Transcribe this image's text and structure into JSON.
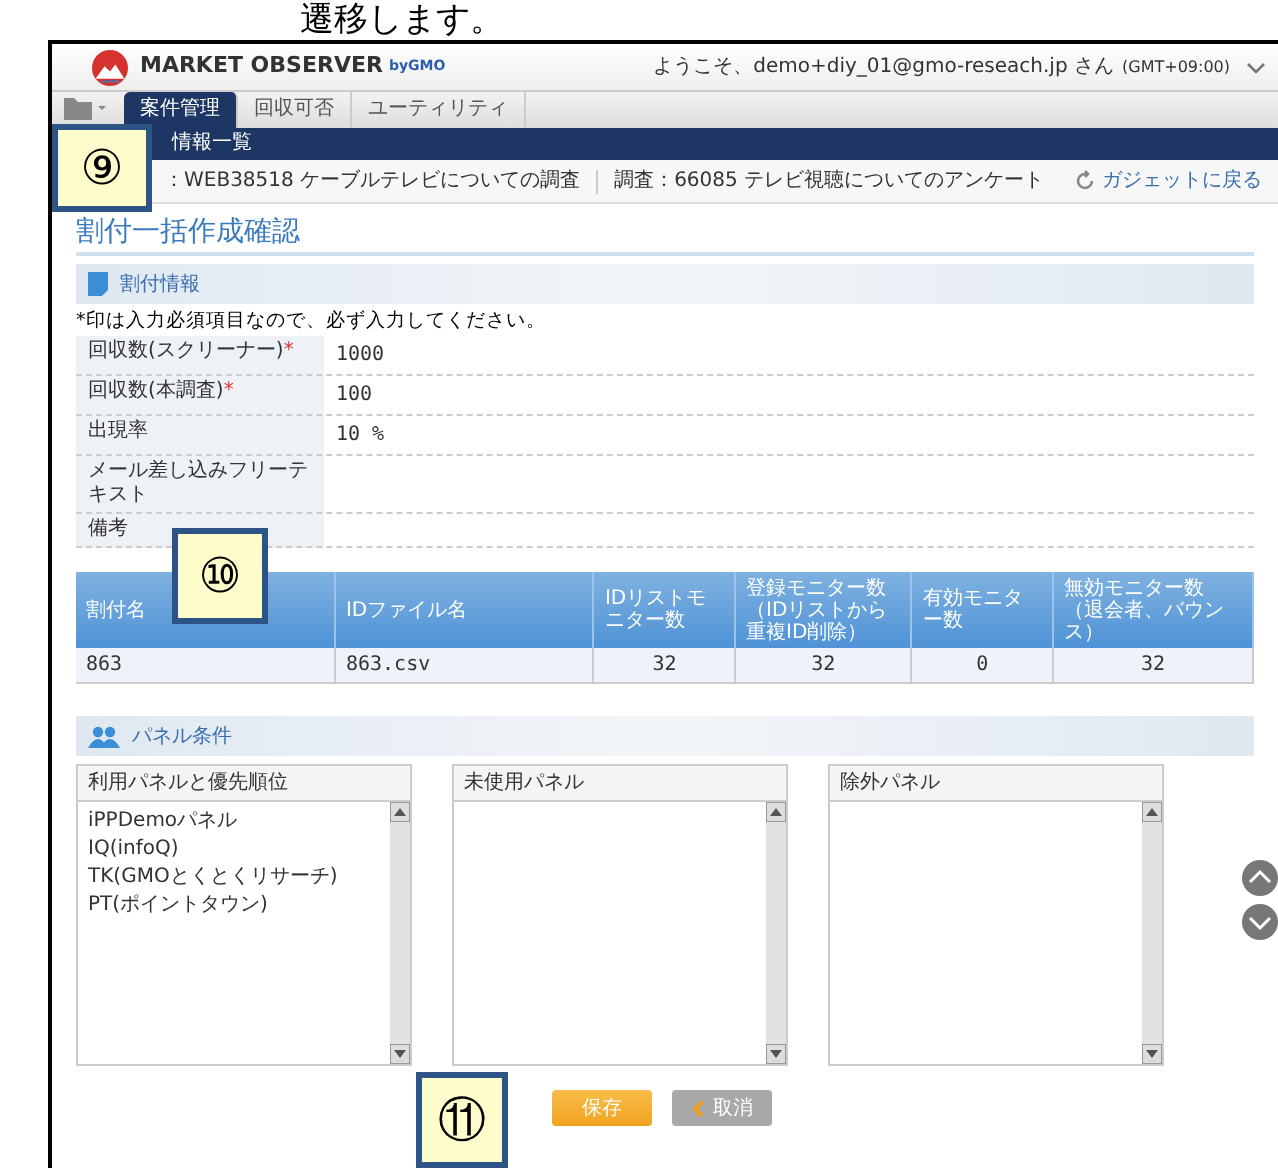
{
  "doc_text": "遷移します。",
  "header": {
    "brand": "MARKET OBSERVER",
    "brand_suffix": "byGMO",
    "welcome": "ようこそ、demo+diy_01@gmo-reseach.jp さん",
    "timezone": "(GMT+09:00)"
  },
  "tabs": [
    {
      "label": "案件管理",
      "selected": true
    },
    {
      "label": "回収可否",
      "selected": false
    },
    {
      "label": "ユーティリティ",
      "selected": false
    }
  ],
  "subnav": "情報一覧",
  "breadcrumb": [
    "：WEB38518 ケーブルテレビについての調査",
    "調査：66085 テレビ視聴についてのアンケート"
  ],
  "back_link": "ガジェットに戻る",
  "page_title": "割付一括作成確認",
  "info_section": {
    "title": "割付情報",
    "required_mark": "*",
    "note": "*印は入力必須項目なので、必ず入力してください。",
    "rows": [
      {
        "label": "回収数(スクリーナー)",
        "required": true,
        "value": "1000"
      },
      {
        "label": "回収数(本調査)",
        "required": true,
        "value": "100"
      },
      {
        "label": "出現率",
        "required": false,
        "value": "10 %"
      },
      {
        "label": "メール差し込みフリーテキスト",
        "required": false
      },
      {
        "label": "備考",
        "required": false
      }
    ]
  },
  "table": {
    "columns": [
      "割付名",
      "IDファイル名",
      "IDリストモニター数",
      "登録モニター数（IDリストから重複ID削除）",
      "有効モニター数",
      "無効モニター数（退会者、バウンス）"
    ],
    "rows": [
      [
        "863",
        "863.csv",
        "32",
        "32",
        "0",
        "32"
      ]
    ]
  },
  "panel_section": {
    "title": "パネル条件",
    "lists": [
      {
        "title": "利用パネルと優先順位",
        "items": [
          "iPPDemoパネル",
          "IQ(infoQ)",
          "TK(GMOとくとくリサーチ)",
          "PT(ポイントタウン)"
        ]
      },
      {
        "title": "未使用パネル"
      },
      {
        "title": "除外パネル"
      }
    ]
  },
  "buttons": [
    {
      "label": "保存",
      "kind": "primary"
    },
    {
      "label": "取消",
      "kind": "back"
    }
  ],
  "callouts": [
    "⑨",
    "⑩",
    "⑪"
  ]
}
